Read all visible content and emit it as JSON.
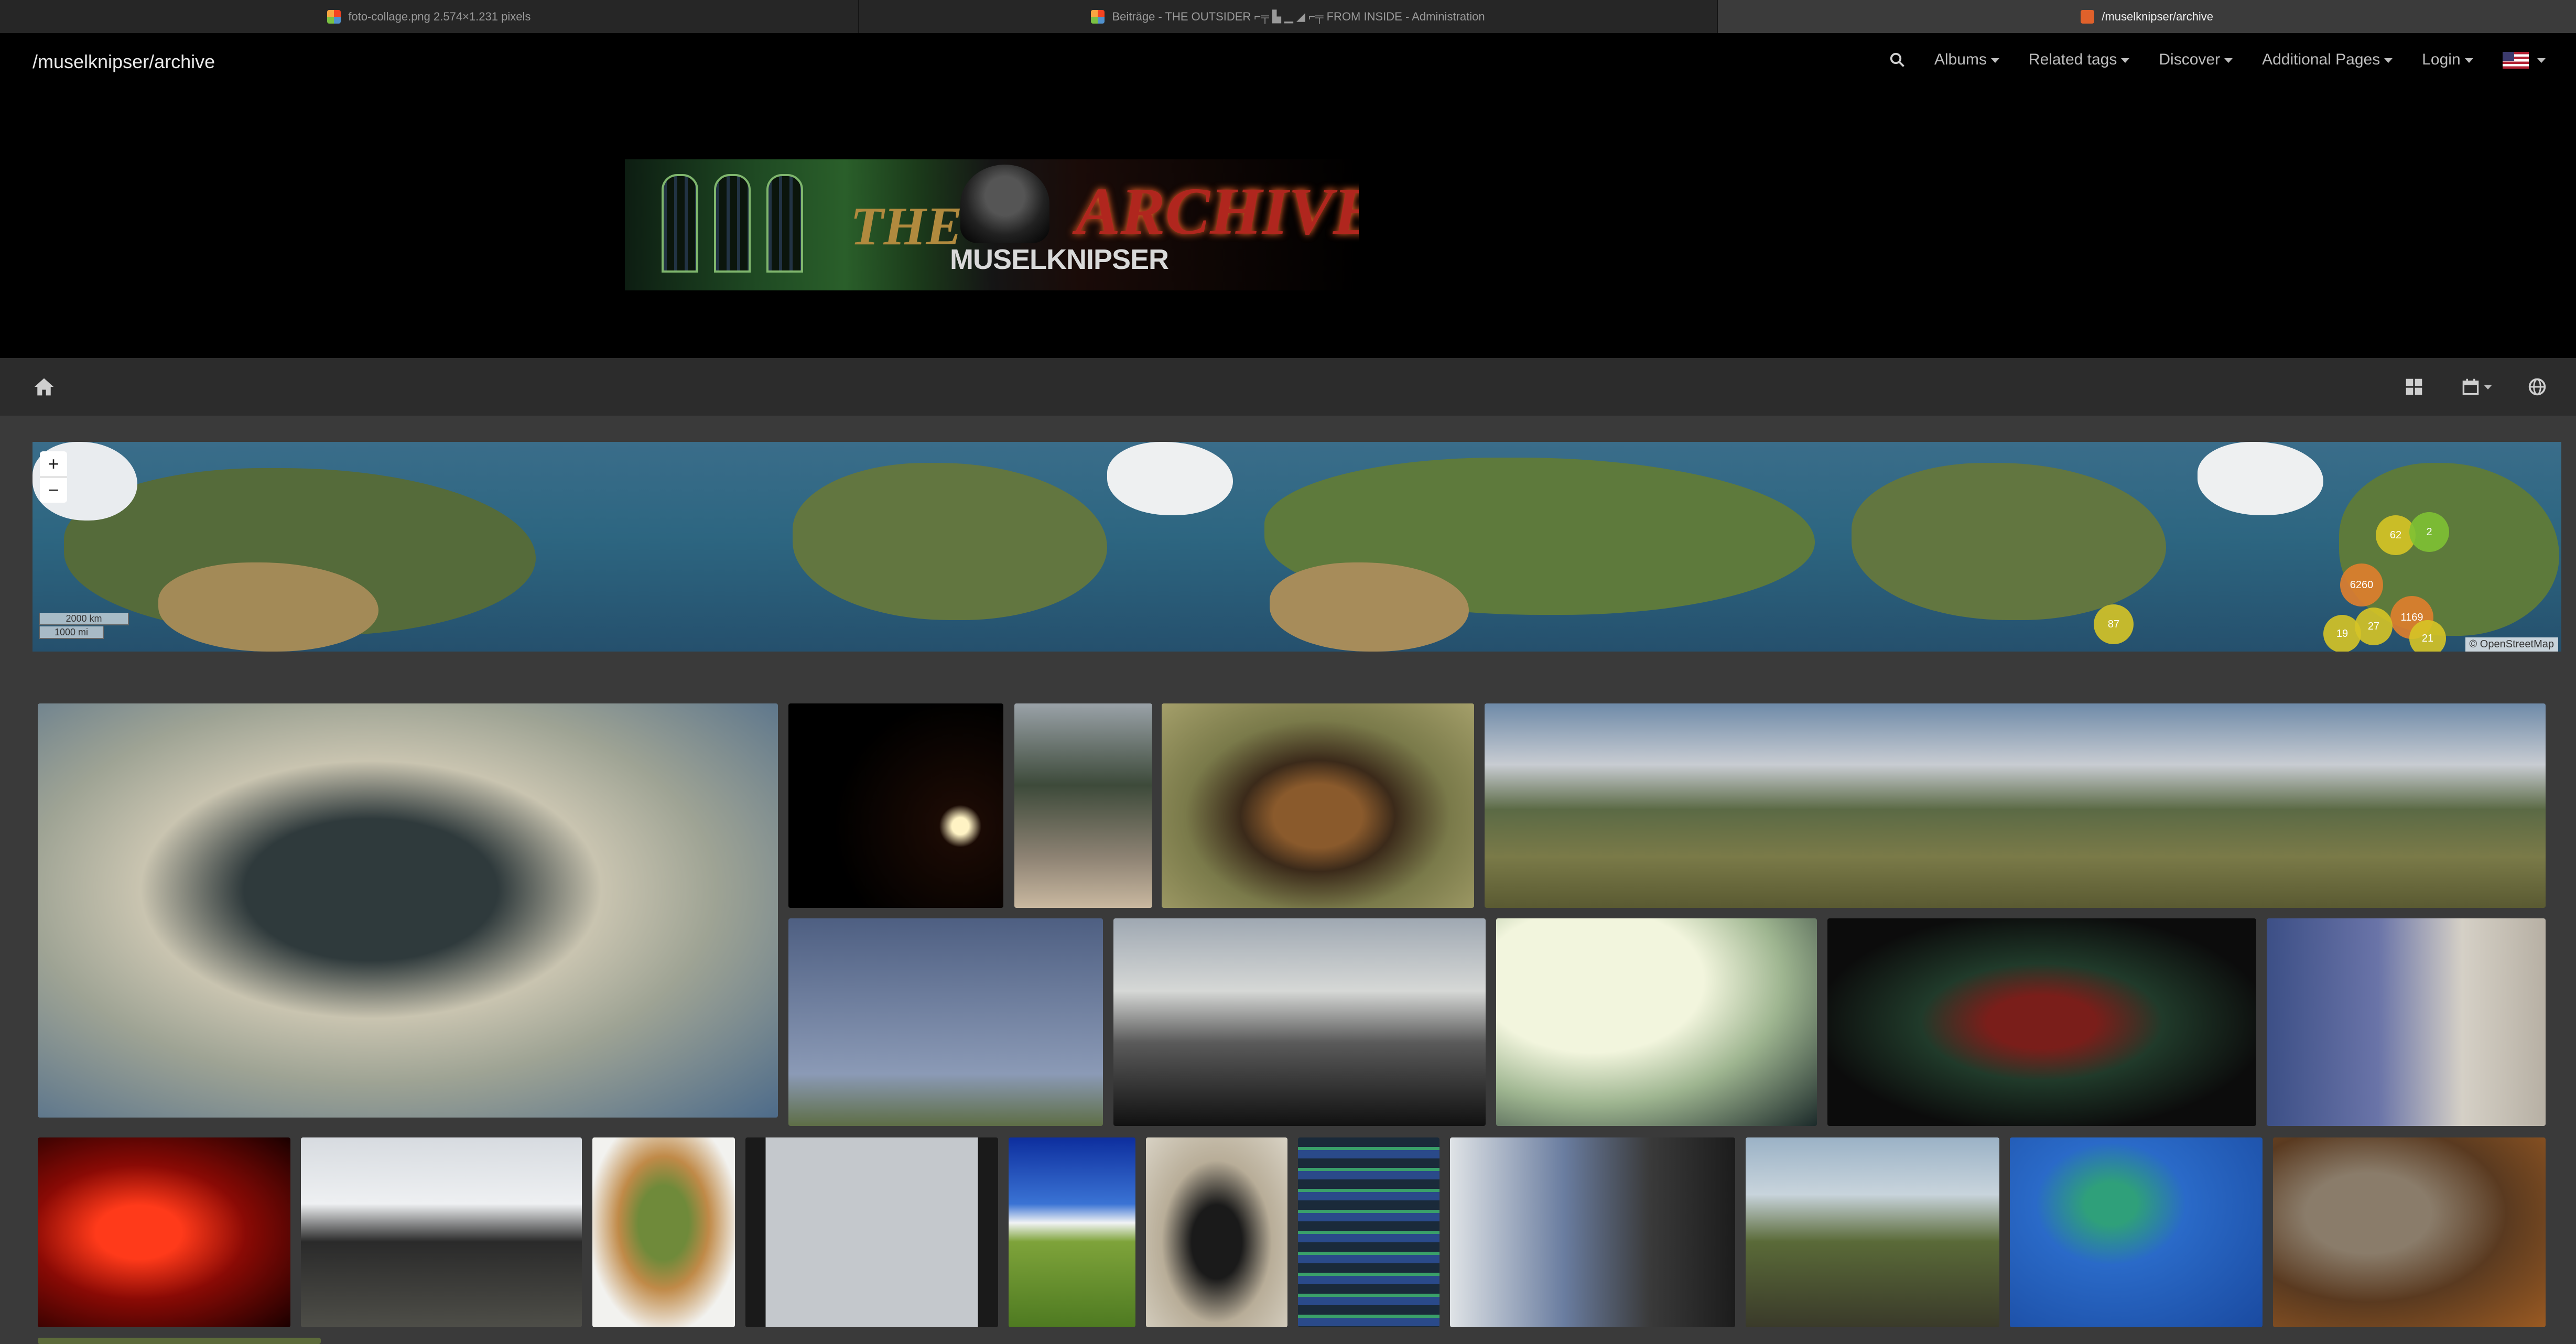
{
  "browser": {
    "tabs": [
      {
        "title": "foto-collage.png 2.574×1.231 pixels",
        "icon": "joomla-icon",
        "active": false
      },
      {
        "title": "Beiträge - THE OUTSIDER ⌐╤ ▙ ▁ ◢ ⌐╤ FROM INSIDE - Administration",
        "icon": "joomla-icon",
        "active": false
      },
      {
        "title": "/muselknipser/archive",
        "icon": "site-icon",
        "active": true
      }
    ]
  },
  "nav": {
    "brand": "/muselknipser/archive",
    "menu": [
      "Albums",
      "Related tags",
      "Discover",
      "Additional Pages",
      "Login"
    ],
    "language_icon": "us-flag-icon"
  },
  "banner": {
    "title": "ARCHIVE",
    "prefix": "THE",
    "logo_text": "MUSELKNIPSER"
  },
  "toolbar": {
    "home_icon": "home-icon",
    "right_icons": [
      "grid-view-icon",
      "calendar-icon",
      "globe-icon"
    ]
  },
  "map": {
    "zoom_in": "+",
    "zoom_out": "−",
    "scale": [
      "2000 km",
      "1000 mi"
    ],
    "attribution": "© OpenStreetMap",
    "clusters": [
      "62",
      "2",
      "6260",
      "87",
      "1169",
      "19",
      "27",
      "21"
    ]
  },
  "gallery": {
    "photos": [
      "moray-eel-coral-reef",
      "rust-sculpture-at-night",
      "people-on-wall",
      "german-shepherd-dog",
      "viaduct-panorama",
      "biplane-airshow",
      "motorcycle-road-view",
      "airplane-over-building",
      "moc-trier-sign",
      "man-on-sofa",
      "concert-red-light",
      "festival-crowd",
      "food-plate",
      "city-window-view",
      "green-field-blue-sky",
      "parked-motorcycle",
      "server-rack",
      "man-in-airplane-seat",
      "goat-in-village",
      "dive-map-poster",
      "cat-with-toy"
    ]
  }
}
